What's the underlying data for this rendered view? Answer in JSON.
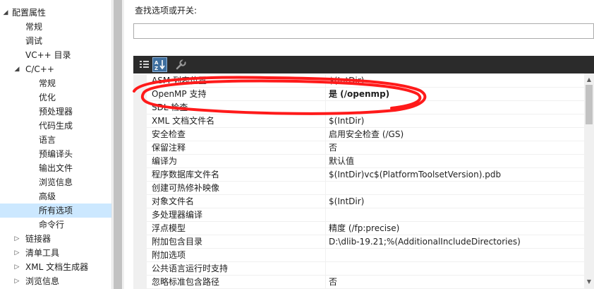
{
  "tree": {
    "items": [
      {
        "label": "配置属性",
        "indent": 0,
        "arrow": "◢",
        "selected": false
      },
      {
        "label": "常规",
        "indent": 1,
        "arrow": "",
        "selected": false
      },
      {
        "label": "调试",
        "indent": 1,
        "arrow": "",
        "selected": false
      },
      {
        "label": "VC++ 目录",
        "indent": 1,
        "arrow": "",
        "selected": false
      },
      {
        "label": "C/C++",
        "indent": 1,
        "arrow": "◢",
        "selected": false
      },
      {
        "label": "常规",
        "indent": 2,
        "arrow": "",
        "selected": false
      },
      {
        "label": "优化",
        "indent": 2,
        "arrow": "",
        "selected": false
      },
      {
        "label": "预处理器",
        "indent": 2,
        "arrow": "",
        "selected": false
      },
      {
        "label": "代码生成",
        "indent": 2,
        "arrow": "",
        "selected": false
      },
      {
        "label": "语言",
        "indent": 2,
        "arrow": "",
        "selected": false
      },
      {
        "label": "预编译头",
        "indent": 2,
        "arrow": "",
        "selected": false
      },
      {
        "label": "输出文件",
        "indent": 2,
        "arrow": "",
        "selected": false
      },
      {
        "label": "浏览信息",
        "indent": 2,
        "arrow": "",
        "selected": false
      },
      {
        "label": "高级",
        "indent": 2,
        "arrow": "",
        "selected": false
      },
      {
        "label": "所有选项",
        "indent": 2,
        "arrow": "",
        "selected": true
      },
      {
        "label": "命令行",
        "indent": 2,
        "arrow": "",
        "selected": false
      },
      {
        "label": "链接器",
        "indent": 1,
        "arrow": "▷",
        "selected": false
      },
      {
        "label": "清单工具",
        "indent": 1,
        "arrow": "▷",
        "selected": false
      },
      {
        "label": "XML 文档生成器",
        "indent": 1,
        "arrow": "▷",
        "selected": false
      },
      {
        "label": "浏览信息",
        "indent": 1,
        "arrow": "▷",
        "selected": false
      }
    ]
  },
  "search": {
    "label": "查找选项或开关:",
    "value": ""
  },
  "toolbar": {
    "categorized_icon": "categorized-icon",
    "alphabetical_icon": "alphabetical-icon",
    "property_pages_icon": "wrench-icon"
  },
  "grid": {
    "rows": [
      {
        "name": "ASM 列表位置",
        "value": "$(IntDir)",
        "bold": false
      },
      {
        "name": "OpenMP 支持",
        "value": "是 (/openmp)",
        "bold": true
      },
      {
        "name": "SDL 检查",
        "value": "",
        "bold": false
      },
      {
        "name": "XML 文档文件名",
        "value": "$(IntDir)",
        "bold": false
      },
      {
        "name": "安全检查",
        "value": "启用安全检查 (/GS)",
        "bold": false
      },
      {
        "name": "保留注释",
        "value": "否",
        "bold": false
      },
      {
        "name": "编译为",
        "value": "默认值",
        "bold": false
      },
      {
        "name": "程序数据库文件名",
        "value": "$(IntDir)vc$(PlatformToolsetVersion).pdb",
        "bold": false
      },
      {
        "name": "创建可热修补映像",
        "value": "",
        "bold": false
      },
      {
        "name": "对象文件名",
        "value": "$(IntDir)",
        "bold": false
      },
      {
        "name": "多处理器编译",
        "value": "",
        "bold": false
      },
      {
        "name": "浮点模型",
        "value": "精度 (/fp:precise)",
        "bold": false
      },
      {
        "name": "附加包含目录",
        "value": "D:\\dlib-19.21;%(AdditionalIncludeDirectories)",
        "bold": false
      },
      {
        "name": "附加选项",
        "value": "",
        "bold": false
      },
      {
        "name": "公共语言运行时支持",
        "value": "",
        "bold": false
      },
      {
        "name": "忽略标准包含路径",
        "value": "否",
        "bold": false
      }
    ]
  },
  "colors": {
    "toolbar_bg": "#2b2b2b",
    "selection": "#cce8ff",
    "annotation": "#ff1a1a"
  }
}
